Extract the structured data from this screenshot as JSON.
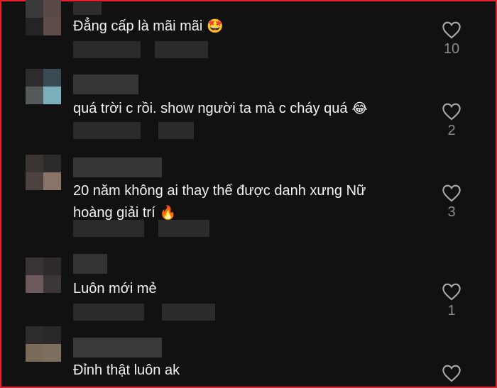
{
  "comments": [
    {
      "text": "Đẳng cấp là mãi mãi",
      "emoji": "🤩",
      "likes": "10"
    },
    {
      "text": "quá trời c rồi. show người ta mà c cháy quá",
      "emoji": "😂",
      "likes": "2"
    },
    {
      "text_line1": "20 năm không ai thay thế được danh xưng Nữ",
      "text_line2": "hoàng giải trí",
      "emoji": "🔥",
      "likes": "3"
    },
    {
      "text": "Luôn mới mẻ",
      "likes": "1"
    },
    {
      "text": "Đỉnh thật luôn ak"
    }
  ],
  "icons": {
    "like": "heart-outline-icon"
  },
  "colors": {
    "background": "#111111",
    "border": "#e8202c",
    "muted": "#8c8c8c"
  }
}
